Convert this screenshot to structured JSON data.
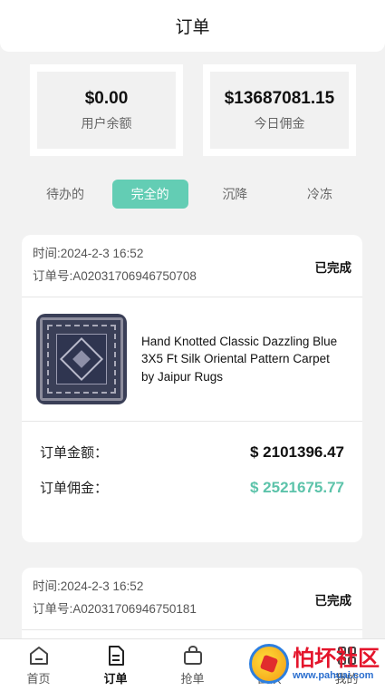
{
  "header": {
    "title": "订单"
  },
  "stats": [
    {
      "value": "$0.00",
      "label": "用户余额"
    },
    {
      "value": "$13687081.15",
      "label": "今日佣金"
    }
  ],
  "tabs": [
    {
      "label": "待办的",
      "active": false
    },
    {
      "label": "完全的",
      "active": true
    },
    {
      "label": "沉降",
      "active": false
    },
    {
      "label": "冷冻",
      "active": false
    }
  ],
  "orders": [
    {
      "time": "时间:2024-2-3 16:52",
      "order_no": "订单号:A02031706946750708",
      "status": "已完成",
      "product_name": "Hand Knotted Classic Dazzling Blue 3X5 Ft Silk Oriental Pattern Carpet by Jaipur Rugs",
      "amount_label": "订单金额：",
      "amount_value": "$ 2101396.47",
      "commission_label": "订单佣金：",
      "commission_value": "$ 2521675.77"
    },
    {
      "time": "时间:2024-2-3 16:52",
      "order_no": "订单号:A02031706946750181",
      "status": "已完成"
    }
  ],
  "bottom_nav": [
    {
      "label": "首页",
      "icon": "home-icon",
      "active": false
    },
    {
      "label": "订单",
      "icon": "order-icon",
      "active": true
    },
    {
      "label": "抢单",
      "icon": "bag-icon",
      "active": false
    },
    {
      "label": "团队",
      "icon": "team-icon",
      "active": false
    },
    {
      "label": "我的",
      "icon": "grid-icon",
      "active": false
    }
  ],
  "watermark": {
    "title": "怕坏社区",
    "url": "www.pahuai.com"
  },
  "colors": {
    "accent": "#63cdb4",
    "commission": "#5cc3aa"
  }
}
